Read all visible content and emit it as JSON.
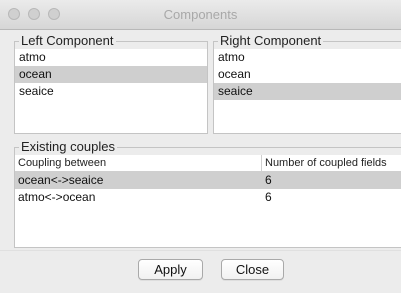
{
  "window": {
    "title": "Components"
  },
  "left_panel": {
    "title": "Left Component",
    "items": [
      {
        "label": "atmo"
      },
      {
        "label": "ocean",
        "selected": true
      },
      {
        "label": "seaice"
      }
    ]
  },
  "right_panel": {
    "title": "Right Component",
    "items": [
      {
        "label": "atmo"
      },
      {
        "label": "ocean"
      },
      {
        "label": "seaice",
        "selected": true
      }
    ]
  },
  "couples": {
    "title": "Existing couples",
    "columns": [
      "Coupling between",
      "Number of coupled fields"
    ],
    "rows": [
      {
        "pair": "ocean<->seaice",
        "fields": "6",
        "selected": true
      },
      {
        "pair": "atmo<->ocean",
        "fields": "6"
      }
    ]
  },
  "buttons": {
    "apply": "Apply",
    "close": "Close"
  },
  "colors": {
    "selection": "#cfcfcf",
    "window_bg": "#ececec",
    "title_text": "#a8a8a8"
  }
}
